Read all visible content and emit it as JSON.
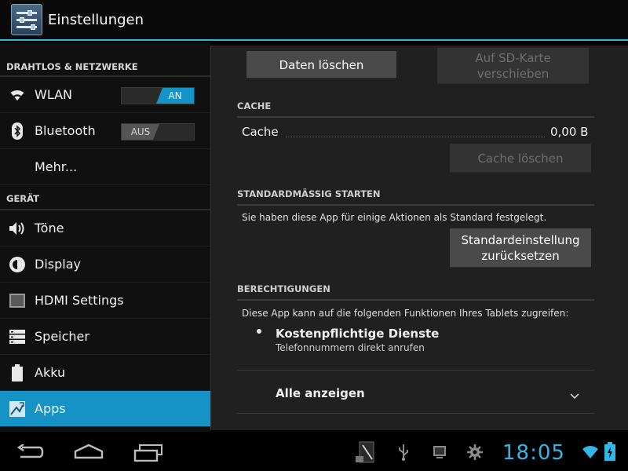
{
  "actionbar": {
    "title": "Einstellungen"
  },
  "sidebar": {
    "sections": [
      {
        "header": "DRAHTLOS & NETZWERKE"
      },
      {
        "header": "GERÄT"
      }
    ],
    "items": [
      {
        "label": "WLAN",
        "icon": "wifi-icon",
        "toggle": "AN"
      },
      {
        "label": "Bluetooth",
        "icon": "bluetooth-icon",
        "toggle": "AUS"
      },
      {
        "label": "Mehr..."
      },
      {
        "label": "Töne",
        "icon": "speaker-icon"
      },
      {
        "label": "Display",
        "icon": "brightness-icon"
      },
      {
        "label": "HDMI Settings",
        "icon": "hdmi-icon"
      },
      {
        "label": "Speicher",
        "icon": "storage-icon"
      },
      {
        "label": "Akku",
        "icon": "battery-icon"
      },
      {
        "label": "Apps",
        "icon": "apps-icon"
      }
    ]
  },
  "content": {
    "clear_data_button": "Daten löschen",
    "move_sd_button_line1": "Auf SD-Karte",
    "move_sd_button_line2": "verschieben",
    "cache": {
      "header": "CACHE",
      "label": "Cache",
      "value": "0,00 B",
      "clear_button": "Cache löschen"
    },
    "default_launch": {
      "header": "STANDARDMÄSSIG STARTEN",
      "description": "Sie haben diese App für einige Aktionen als Standard festgelegt.",
      "reset_button_line1": "Standardeinstellung",
      "reset_button_line2": "zurücksetzen"
    },
    "permissions": {
      "header": "BERECHTIGUNGEN",
      "description": "Diese App kann auf die folgenden Funktionen Ihres Tablets zugreifen:",
      "item_title": "Kostenpflichtige Dienste",
      "item_subtitle": "Telefonnummern direkt anrufen",
      "show_all": "Alle anzeigen"
    }
  },
  "statusbar": {
    "time": "18:05"
  },
  "colors": {
    "accent": "#33b5e5",
    "selected": "#1693c6"
  }
}
